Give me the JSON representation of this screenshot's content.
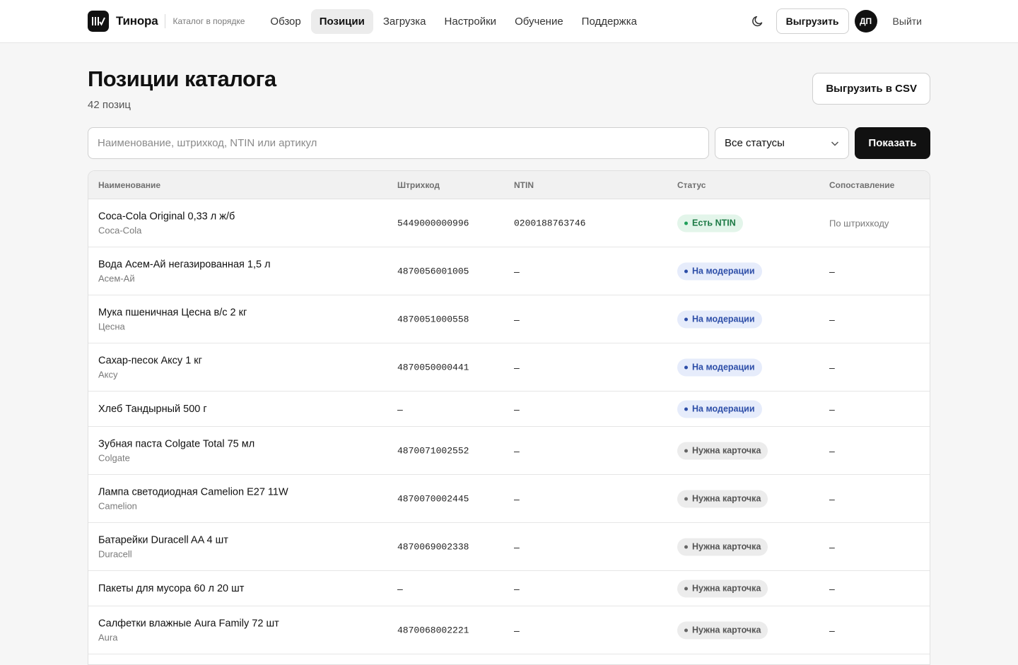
{
  "brand": {
    "name": "Тинора",
    "tagline": "Каталог в порядке"
  },
  "nav": [
    {
      "label": "Обзор",
      "active": false
    },
    {
      "label": "Позиции",
      "active": true
    },
    {
      "label": "Загрузка",
      "active": false
    },
    {
      "label": "Настройки",
      "active": false
    },
    {
      "label": "Обучение",
      "active": false
    },
    {
      "label": "Поддержка",
      "active": false
    }
  ],
  "topbar": {
    "theme_icon": "moon-icon",
    "export_label": "Выгрузить",
    "avatar_initials": "ДП",
    "logout_label": "Выйти"
  },
  "page": {
    "title": "Позиции каталога",
    "count": "42 позиц",
    "csv_label": "Выгрузить в CSV"
  },
  "filters": {
    "search_placeholder": "Наименование, штрихкод, NTIN или артикул",
    "status_value": "Все статусы",
    "show_label": "Показать"
  },
  "table": {
    "headers": {
      "name": "Наименование",
      "barcode": "Штрихкод",
      "ntin": "NTIN",
      "status": "Статус",
      "match": "Сопоставление"
    },
    "rows": [
      {
        "name": "Coca-Cola Original 0,33 л ж/б",
        "brand": "Coca-Cola",
        "barcode": "5449000000996",
        "ntin": "0200188763746",
        "status": "Есть NTIN",
        "status_tone": "green",
        "match": "По штрихкоду"
      },
      {
        "name": "Вода Асем-Ай негазированная 1,5 л",
        "brand": "Асем-Ай",
        "barcode": "4870056001005",
        "ntin": "–",
        "status": "На модерации",
        "status_tone": "blue",
        "match": "–"
      },
      {
        "name": "Мука пшеничная Цесна в/с 2 кг",
        "brand": "Цесна",
        "barcode": "4870051000558",
        "ntin": "–",
        "status": "На модерации",
        "status_tone": "blue",
        "match": "–"
      },
      {
        "name": "Сахар-песок Аксу 1 кг",
        "brand": "Аксу",
        "barcode": "4870050000441",
        "ntin": "–",
        "status": "На модерации",
        "status_tone": "blue",
        "match": "–"
      },
      {
        "name": "Хлеб Тандырный 500 г",
        "brand": "",
        "barcode": "–",
        "ntin": "–",
        "status": "На модерации",
        "status_tone": "blue",
        "match": "–"
      },
      {
        "name": "Зубная паста Colgate Total 75 мл",
        "brand": "Colgate",
        "barcode": "4870071002552",
        "ntin": "–",
        "status": "Нужна карточка",
        "status_tone": "gray",
        "match": "–"
      },
      {
        "name": "Лампа светодиодная Camelion E27 11W",
        "brand": "Camelion",
        "barcode": "4870070002445",
        "ntin": "–",
        "status": "Нужна карточка",
        "status_tone": "gray",
        "match": "–"
      },
      {
        "name": "Батарейки Duracell AA 4 шт",
        "brand": "Duracell",
        "barcode": "4870069002338",
        "ntin": "–",
        "status": "Нужна карточка",
        "status_tone": "gray",
        "match": "–"
      },
      {
        "name": "Пакеты для мусора 60 л 20 шт",
        "brand": "",
        "barcode": "–",
        "ntin": "–",
        "status": "Нужна карточка",
        "status_tone": "gray",
        "match": "–"
      },
      {
        "name": "Салфетки влажные Aura Family 72 шт",
        "brand": "Aura",
        "barcode": "4870068002221",
        "ntin": "–",
        "status": "Нужна карточка",
        "status_tone": "gray",
        "match": "–"
      }
    ]
  }
}
